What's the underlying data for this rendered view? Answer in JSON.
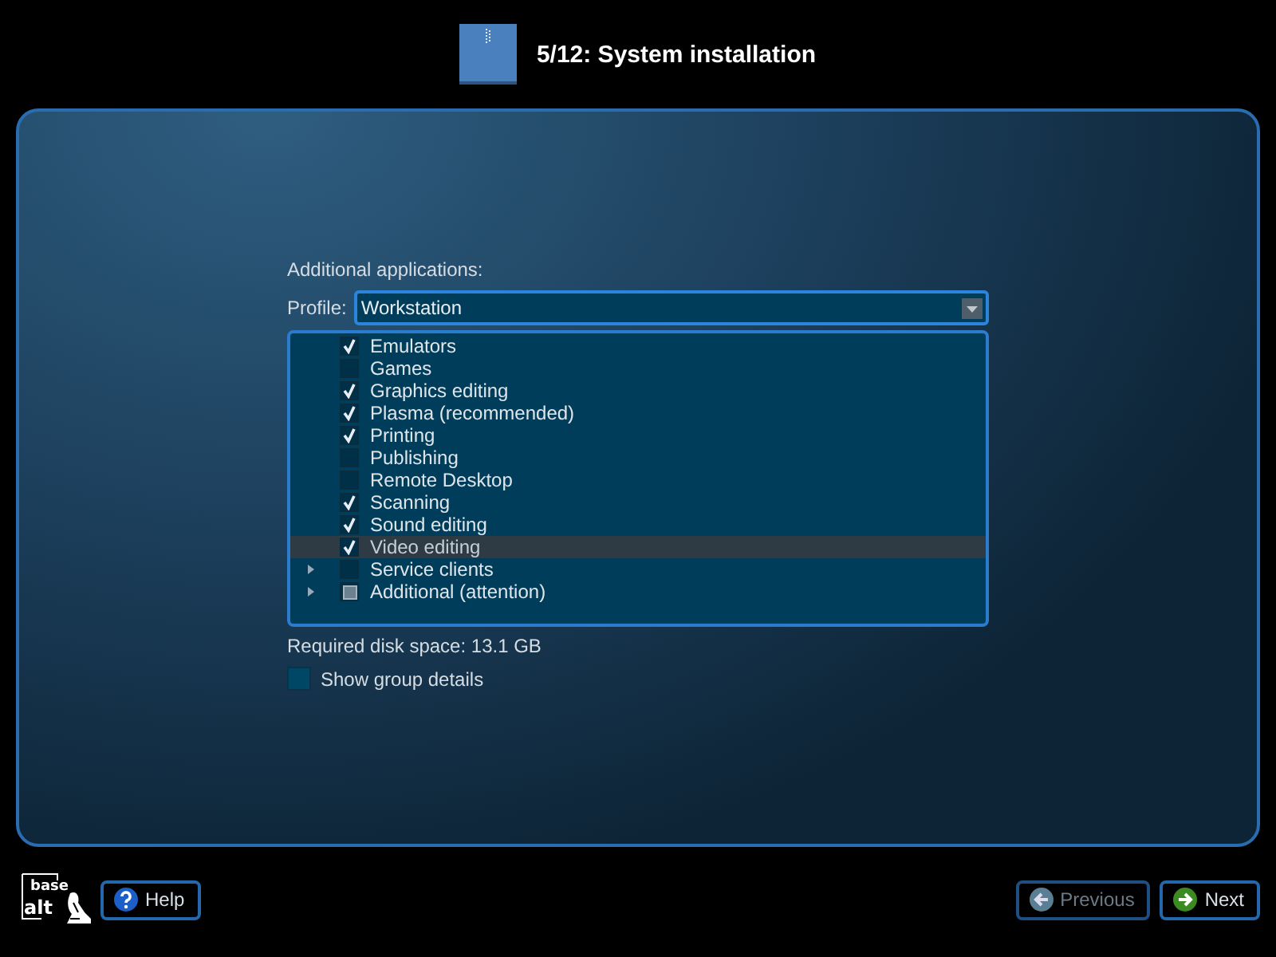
{
  "header": {
    "title": "5/12: System installation"
  },
  "section": {
    "heading": "Additional applications:",
    "profile_label": "Profile:",
    "profile_value": "Workstation"
  },
  "groups": [
    {
      "label": "Emulators",
      "kind": "item",
      "checked": true,
      "partial": false,
      "selected": false
    },
    {
      "label": "Games",
      "kind": "item",
      "checked": false,
      "partial": false,
      "selected": false
    },
    {
      "label": "Graphics editing",
      "kind": "item",
      "checked": true,
      "partial": false,
      "selected": false
    },
    {
      "label": "Plasma (recommended)",
      "kind": "item",
      "checked": true,
      "partial": false,
      "selected": false
    },
    {
      "label": "Printing",
      "kind": "item",
      "checked": true,
      "partial": false,
      "selected": false
    },
    {
      "label": "Publishing",
      "kind": "item",
      "checked": false,
      "partial": false,
      "selected": false
    },
    {
      "label": "Remote Desktop",
      "kind": "item",
      "checked": false,
      "partial": false,
      "selected": false
    },
    {
      "label": "Scanning",
      "kind": "item",
      "checked": true,
      "partial": false,
      "selected": false
    },
    {
      "label": "Sound editing",
      "kind": "item",
      "checked": true,
      "partial": false,
      "selected": false
    },
    {
      "label": "Video editing",
      "kind": "item",
      "checked": true,
      "partial": false,
      "selected": true
    },
    {
      "label": "Service clients",
      "kind": "group",
      "expanded": false,
      "checked": false,
      "partial": false,
      "selected": false
    },
    {
      "label": "Additional (attention)",
      "kind": "group",
      "expanded": false,
      "checked": false,
      "partial": true,
      "selected": false
    }
  ],
  "disk_space": "Required disk space: 13.1 GB",
  "show_details": {
    "label": "Show group details",
    "checked": false
  },
  "logo": {
    "line_1": "base",
    "line_2": "alt"
  },
  "buttons": [
    {
      "label": "Help",
      "kind": "help",
      "disabled": false
    },
    {
      "label": "Previous",
      "kind": "previous",
      "disabled": true
    },
    {
      "label": "Next",
      "kind": "next",
      "disabled": false
    }
  ]
}
